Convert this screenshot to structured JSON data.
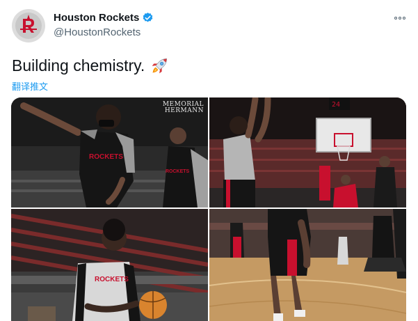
{
  "author": {
    "display_name": "Houston Rockets",
    "handle": "@HoustonRockets",
    "verified": true,
    "avatar_icon": "rockets-logo-icon"
  },
  "tweet": {
    "text": "Building chemistry.",
    "emoji": "rocket-emoji",
    "translate_label": "翻译推文"
  },
  "media": {
    "photos": [
      {
        "description_icon": "photo-player-shooting-pose"
      },
      {
        "description_icon": "photo-player-jump-shot"
      },
      {
        "description_icon": "photo-player-holding-ball"
      },
      {
        "description_icon": "photo-player-legs-court"
      }
    ],
    "watermark_line1": "MEMORIAL",
    "watermark_line2": "HERMANN"
  },
  "colors": {
    "accent": "#1d9bf0",
    "rockets_red": "#c8102e",
    "text_secondary": "#536471"
  }
}
